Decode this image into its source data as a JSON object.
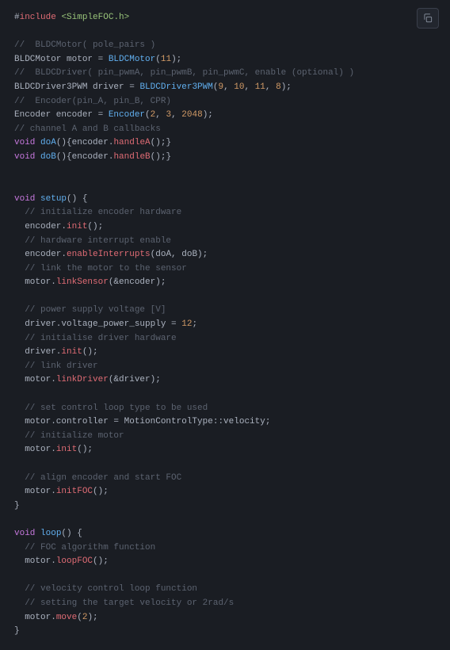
{
  "copy_tooltip": "Copy",
  "code": {
    "l1": {
      "a": "#",
      "b": "include",
      "c": " ",
      "d": "<SimpleFOC.h>"
    },
    "l2": "",
    "l3": "//  BLDCMotor( pole_pairs )",
    "l4": {
      "a": "BLDCMotor motor = ",
      "b": "BLDCMotor",
      "c": "(",
      "d": "11",
      "e": ");"
    },
    "l5": "//  BLDCDriver( pin_pwmA, pin_pwmB, pin_pwmC, enable (optional) )",
    "l6": {
      "a": "BLDCDriver3PWM driver = ",
      "b": "BLDCDriver3PWM",
      "c": "(",
      "d": "9",
      "e": ", ",
      "f": "10",
      "g": ", ",
      "h": "11",
      "i": ", ",
      "j": "8",
      "k": ");"
    },
    "l7": "//  Encoder(pin_A, pin_B, CPR)",
    "l8": {
      "a": "Encoder encoder = ",
      "b": "Encoder",
      "c": "(",
      "d": "2",
      "e": ", ",
      "f": "3",
      "g": ", ",
      "h": "2048",
      "i": ");"
    },
    "l9": "// channel A and B callbacks",
    "l10": {
      "a": "void",
      "b": " ",
      "c": "doA",
      "d": "(){encoder.",
      "e": "handleA",
      "f": "();}"
    },
    "l11": {
      "a": "void",
      "b": " ",
      "c": "doB",
      "d": "(){encoder.",
      "e": "handleB",
      "f": "();}"
    },
    "l12": "",
    "l13": "",
    "l14": {
      "a": "void",
      "b": " ",
      "c": "setup",
      "d": "() {"
    },
    "l15": "  // initialize encoder hardware",
    "l16": {
      "a": "  encoder.",
      "b": "init",
      "c": "();"
    },
    "l17": "  // hardware interrupt enable",
    "l18": {
      "a": "  encoder.",
      "b": "enableInterrupts",
      "c": "(doA, doB);"
    },
    "l19": "  // link the motor to the sensor",
    "l20": {
      "a": "  motor.",
      "b": "linkSensor",
      "c": "(&encoder);"
    },
    "l21": "",
    "l22": "  // power supply voltage [V]",
    "l23": {
      "a": "  driver.voltage_power_supply = ",
      "b": "12",
      "c": ";"
    },
    "l24": "  // initialise driver hardware",
    "l25": {
      "a": "  driver.",
      "b": "init",
      "c": "();"
    },
    "l26": "  // link driver",
    "l27": {
      "a": "  motor.",
      "b": "linkDriver",
      "c": "(&driver);"
    },
    "l28": "",
    "l29": "  // set control loop type to be used",
    "l30": "  motor.controller = MotionControlType::velocity;",
    "l31": "  // initialize motor",
    "l32": {
      "a": "  motor.",
      "b": "init",
      "c": "();"
    },
    "l33": "",
    "l34": "  // align encoder and start FOC",
    "l35": {
      "a": "  motor.",
      "b": "initFOC",
      "c": "();"
    },
    "l36": "}",
    "l37": "",
    "l38": {
      "a": "void",
      "b": " ",
      "c": "loop",
      "d": "() {"
    },
    "l39": "  // FOC algorithm function",
    "l40": {
      "a": "  motor.",
      "b": "loopFOC",
      "c": "();"
    },
    "l41": "",
    "l42": "  // velocity control loop function",
    "l43": "  // setting the target velocity or 2rad/s",
    "l44": {
      "a": "  motor.",
      "b": "move",
      "c": "(",
      "d": "2",
      "e": ");"
    },
    "l45": "}"
  }
}
